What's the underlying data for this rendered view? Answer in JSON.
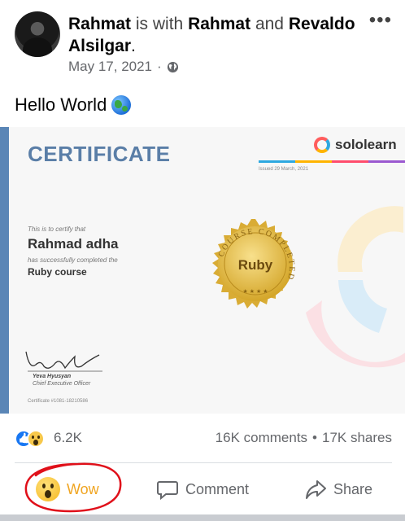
{
  "post": {
    "author": "Rahmat",
    "with_text": "is with",
    "tagged_1": "Rahmat",
    "and_text": "and",
    "tagged_2": "Revaldo Alsilgar",
    "period": ".",
    "date": "May 17, 2021",
    "separator": "·",
    "privacy_icon": "globe-icon",
    "more_icon": "more-options-icon",
    "more_label": "•••",
    "text": "Hello World",
    "text_emoji": "earth-globe-icon"
  },
  "certificate": {
    "title": "CERTIFICATE",
    "brand": "sololearn",
    "issued": "Issued 29 March, 2021",
    "certify_text": "This is to certify that",
    "recipient": "Rahmad adha",
    "completed_text": "has successfully completed the",
    "course": "Ruby course",
    "seal_text": "Ruby",
    "seal_ring_text": "COURSE COMPLETED",
    "signer": "Yeva Hyusyan",
    "signer_role": "Chief Executive Officer",
    "cert_number": "Certificate #1081-18210586",
    "stripe_colors": [
      "#2da8e0",
      "#ffb400",
      "#ff4d6d",
      "#9b59d0"
    ],
    "accent_color": "#5a86b6"
  },
  "engagement": {
    "reaction_count": "6.2K",
    "comments": "16K comments",
    "dot": "•",
    "shares": "17K shares"
  },
  "actions": {
    "wow_label": "Wow",
    "comment_label": "Comment",
    "share_label": "Share",
    "wow_color": "#f0a521"
  },
  "annotation": {
    "color": "#e0101a"
  }
}
